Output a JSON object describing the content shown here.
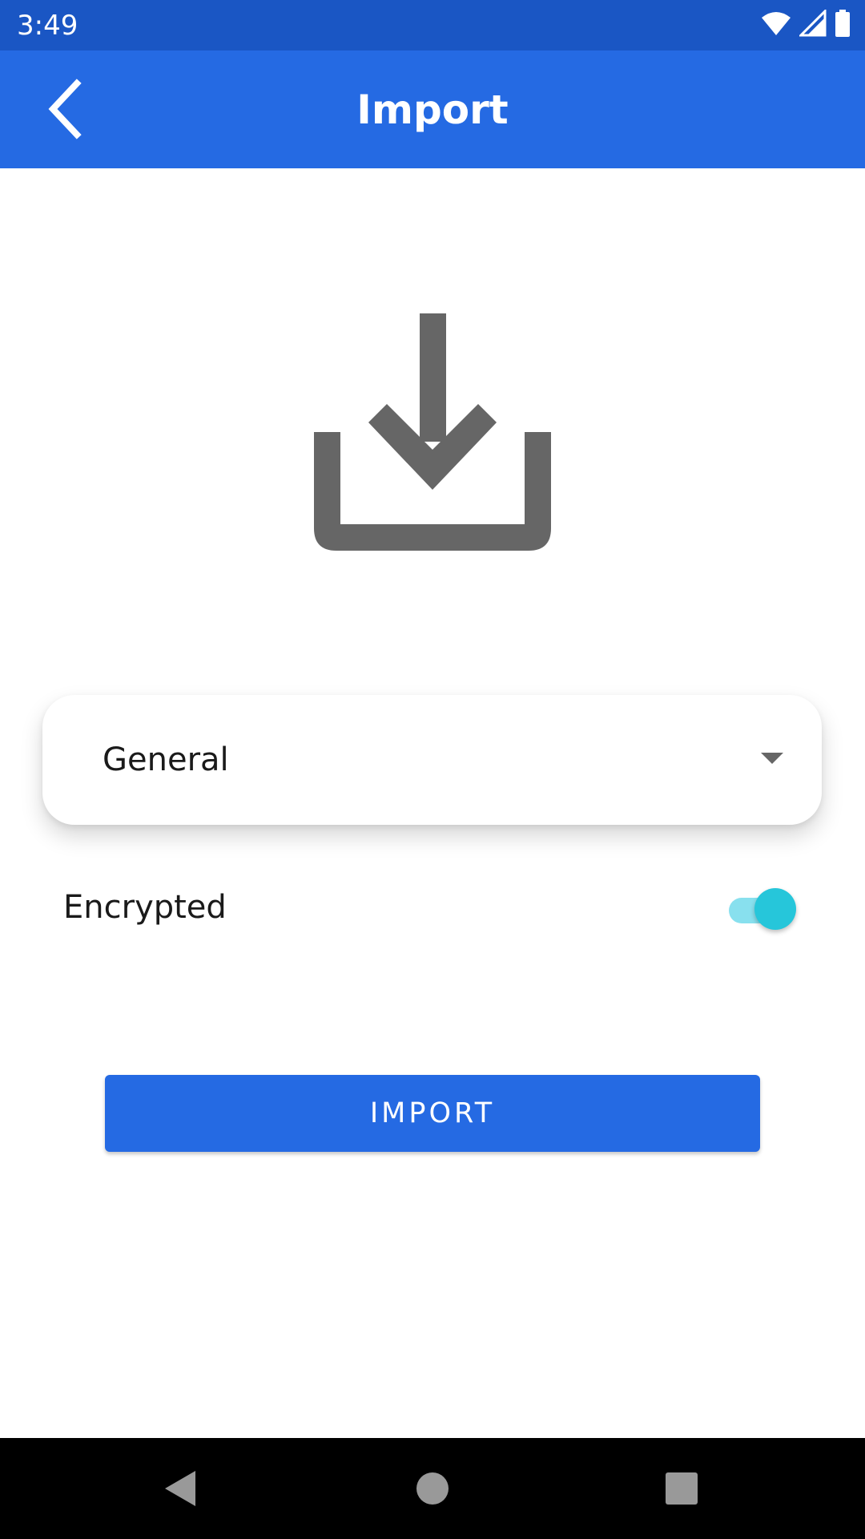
{
  "status_bar": {
    "time": "3:49",
    "icons": [
      "wifi-icon",
      "signal-icon",
      "battery-icon"
    ]
  },
  "app_bar": {
    "title": "Import",
    "back_icon": "chevron-left-icon"
  },
  "illustration": {
    "icon": "download-tray-icon",
    "color": "#666666"
  },
  "dropdown": {
    "selected": "General",
    "caret_icon": "caret-down-icon"
  },
  "encrypted": {
    "label": "Encrypted",
    "enabled": true,
    "accent": "#26c6da"
  },
  "import_button": {
    "label": "IMPORT"
  },
  "nav_bar": {
    "buttons": [
      "back-triangle-icon",
      "home-circle-icon",
      "recents-square-icon"
    ]
  },
  "colors": {
    "status_bar": "#1a56c4",
    "app_bar": "#256ae3",
    "primary": "#256ae3"
  }
}
